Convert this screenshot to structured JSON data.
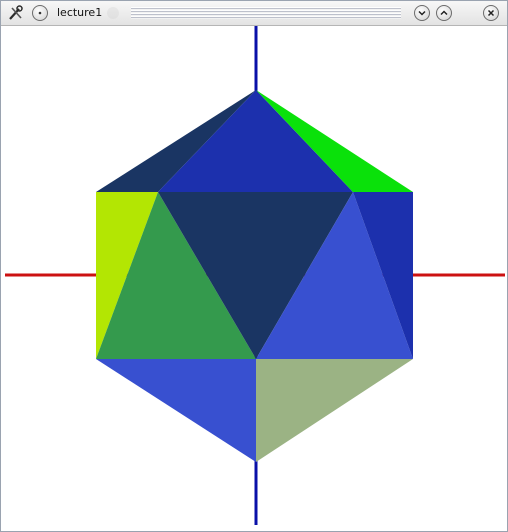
{
  "window": {
    "title": "lecture1"
  },
  "colors": {
    "x_axis": "#cc1111",
    "y_axis": "#0a10a8",
    "faces": [
      "#1a3563",
      "#1c30ad",
      "#0ae10a",
      "#b3e603",
      "#349a4d",
      "#3850d0",
      "#9bb384"
    ]
  },
  "icons": {
    "app": "wrench-icon",
    "menu": "circle-dot-icon",
    "minimize": "chevron-down-icon",
    "maximize": "chevron-up-icon",
    "close": "close-icon"
  }
}
